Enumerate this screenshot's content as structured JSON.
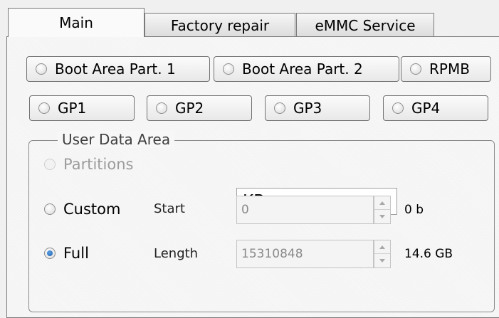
{
  "tabs": [
    {
      "label": "Main",
      "active": true
    },
    {
      "label": "Factory repair",
      "active": false
    },
    {
      "label": "eMMC Service",
      "active": false
    }
  ],
  "partitions_row1": [
    {
      "label": "Boot Area Part. 1",
      "checked": false
    },
    {
      "label": "Boot Area Part. 2",
      "checked": false
    },
    {
      "label": "RPMB",
      "checked": false
    }
  ],
  "partitions_row2": [
    {
      "label": "GP1",
      "checked": false
    },
    {
      "label": "GP2",
      "checked": false
    },
    {
      "label": "GP3",
      "checked": false
    },
    {
      "label": "GP4",
      "checked": false
    }
  ],
  "user_data_area": {
    "legend": "User Data Area",
    "partitions_label": "Partitions",
    "partitions_enabled": false,
    "unit_select": {
      "selected": "KB"
    },
    "custom_label": "Custom",
    "full_label": "Full",
    "selected_option": "Full",
    "start": {
      "label": "Start",
      "value": "0",
      "size_text": "0 b"
    },
    "length": {
      "label": "Length",
      "value": "15310848",
      "size_text": "14.6 GB"
    }
  },
  "colors": {
    "accent": "#1f6fbf",
    "border": "#7a7a7a",
    "disabled_text": "#9c9c9c"
  },
  "icons": {
    "combo_arrow": "chevron-down-icon",
    "spin_up": "arrow-up-icon",
    "spin_down": "arrow-down-icon"
  }
}
